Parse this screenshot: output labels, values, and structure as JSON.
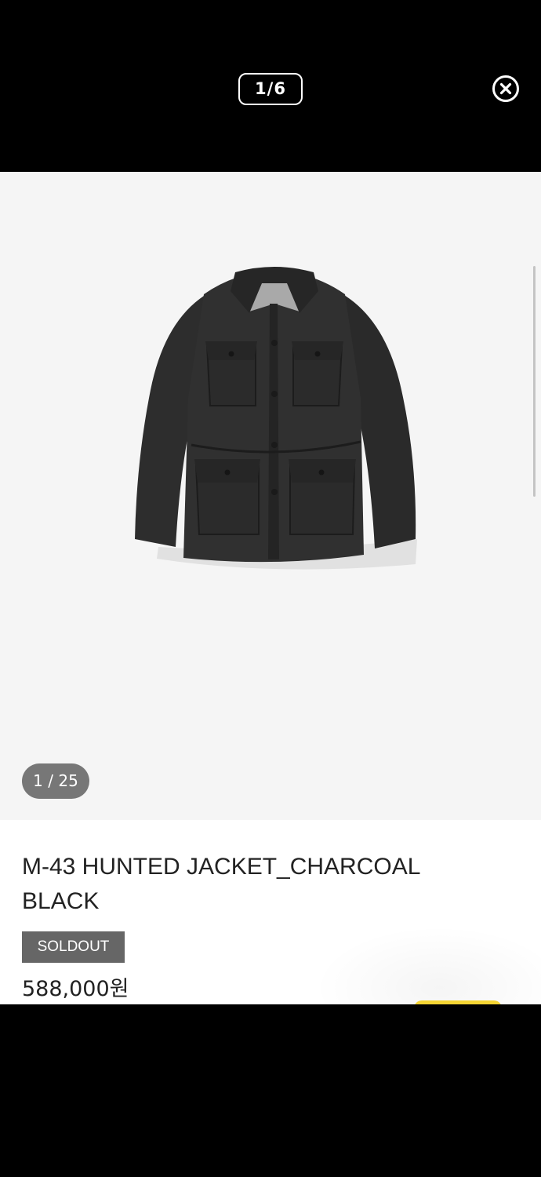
{
  "viewer": {
    "page_counter": "1/6",
    "close_icon": "close-circle-icon"
  },
  "gallery": {
    "image_subject": "jacket-image",
    "counter": "1 / 25"
  },
  "product": {
    "title": "M-43 HUNTED JACKET_CHARCOAL BLACK",
    "status_badge": "SOLDOUT",
    "price": "588,000원"
  },
  "colors": {
    "header_bg": "#000000",
    "gallery_bg": "#f5f5f5",
    "badge_bg": "#666666",
    "counter_bg": "#777777",
    "floating_accent": "#f6d533"
  }
}
